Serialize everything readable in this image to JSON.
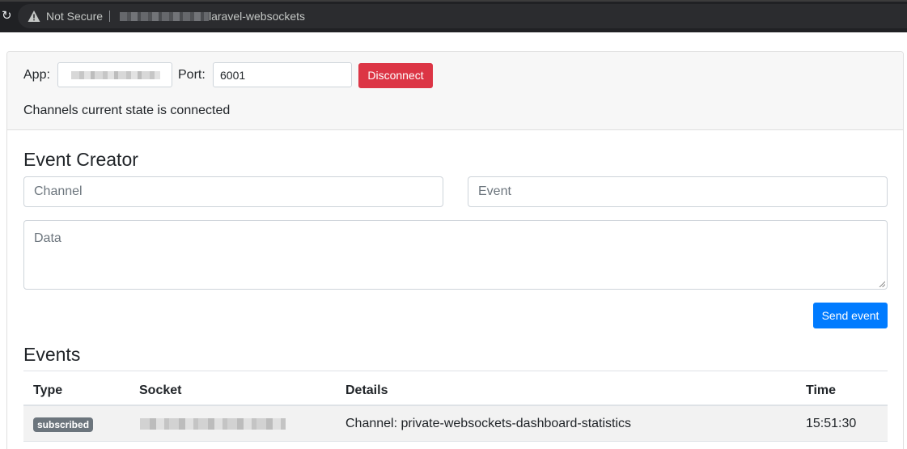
{
  "browser": {
    "security_label": "Not Secure",
    "url_visible": "laravel-websockets"
  },
  "connection": {
    "app_label": "App:",
    "port_label": "Port:",
    "port_value": "6001",
    "disconnect_label": "Disconnect",
    "status_text": "Channels current state is connected"
  },
  "event_creator": {
    "title": "Event Creator",
    "channel_placeholder": "Channel",
    "event_placeholder": "Event",
    "data_placeholder": "Data",
    "send_label": "Send event"
  },
  "events": {
    "title": "Events",
    "columns": [
      "Type",
      "Socket",
      "Details",
      "Time"
    ],
    "rows": [
      {
        "type": "subscribed",
        "details": "Channel: private-websockets-dashboard-statistics",
        "time": "15:51:30"
      }
    ]
  },
  "colors": {
    "danger": "#dc3545",
    "primary": "#007bff",
    "badge": "#6c757d"
  }
}
